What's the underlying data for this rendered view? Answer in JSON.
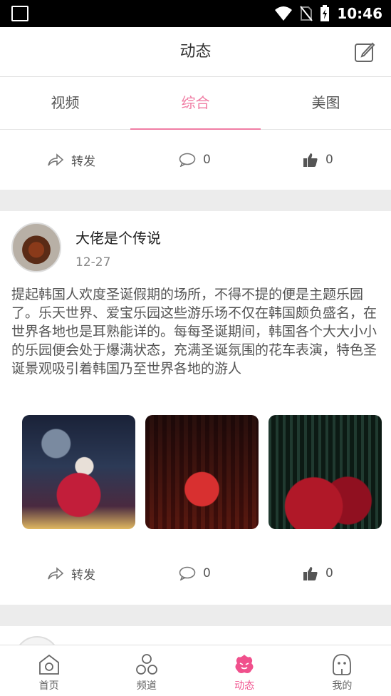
{
  "status_bar": {
    "time": "10:46"
  },
  "header": {
    "title": "动态"
  },
  "tabs": [
    {
      "label": "视频"
    },
    {
      "label": "综合"
    },
    {
      "label": "美图"
    }
  ],
  "posts": [
    {
      "actions": {
        "share": "转发",
        "comments": "0",
        "likes": "0"
      }
    },
    {
      "username": "大佬是个传说",
      "date": "12-27",
      "text": "提起韩国人欢度圣诞假期的场所，不得不提的便是主题乐园了。乐天世界、爱宝乐园这些游乐场不仅在韩国颇负盛名，在世界各地也是耳熟能详的。每每圣诞期间，韩国各个大大小小的乐园便会处于爆满状态，充满圣诞氛围的花车表演，特色圣诞景观吸引着韩国乃至世界各地的游人",
      "actions": {
        "share": "转发",
        "comments": "0",
        "likes": "0"
      }
    }
  ],
  "bottom_nav": [
    {
      "label": "首页"
    },
    {
      "label": "频道"
    },
    {
      "label": "动态"
    },
    {
      "label": "我的"
    }
  ],
  "colors": {
    "accent": "#f07da4",
    "nav_active": "#f0508c"
  }
}
